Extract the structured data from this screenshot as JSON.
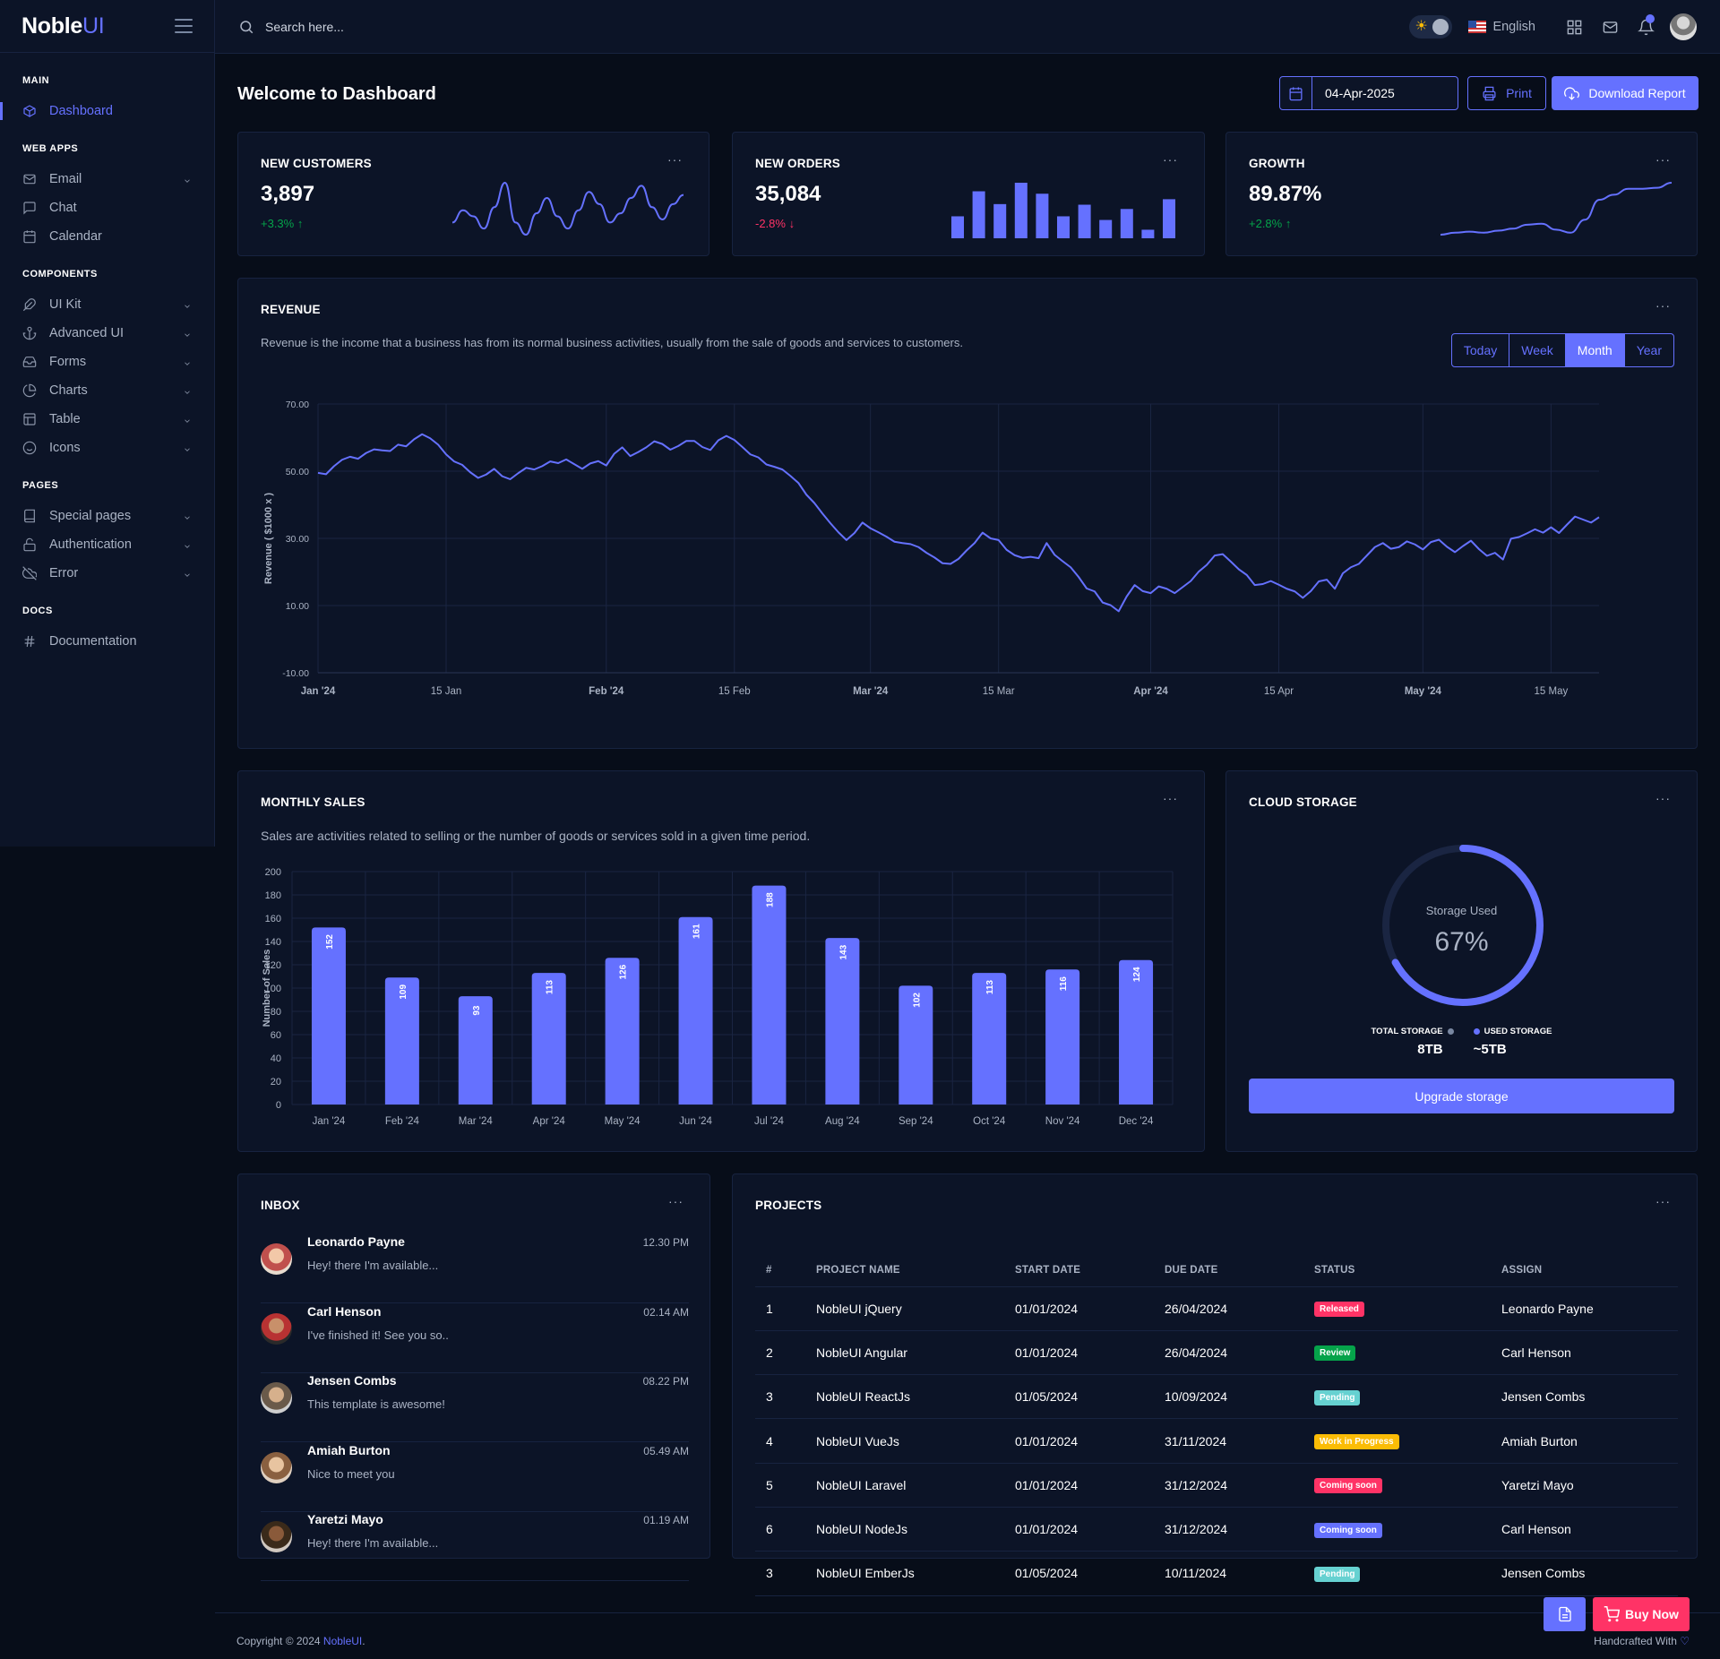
{
  "brand": {
    "name": "Noble",
    "suffix": "UI"
  },
  "search": {
    "placeholder": "Search here..."
  },
  "topbar": {
    "language": "English"
  },
  "sidebar": {
    "groups": [
      {
        "title": "MAIN",
        "items": [
          {
            "label": "Dashboard",
            "icon": "box-icon",
            "active": true
          }
        ]
      },
      {
        "title": "WEB APPS",
        "items": [
          {
            "label": "Email",
            "icon": "mail-icon",
            "chevron": true
          },
          {
            "label": "Chat",
            "icon": "message-square-icon"
          },
          {
            "label": "Calendar",
            "icon": "calendar-icon"
          }
        ]
      },
      {
        "title": "COMPONENTS",
        "items": [
          {
            "label": "UI Kit",
            "icon": "feather-icon",
            "chevron": true
          },
          {
            "label": "Advanced UI",
            "icon": "anchor-icon",
            "chevron": true
          },
          {
            "label": "Forms",
            "icon": "inbox-icon",
            "chevron": true
          },
          {
            "label": "Charts",
            "icon": "pie-chart-icon",
            "chevron": true
          },
          {
            "label": "Table",
            "icon": "layout-icon",
            "chevron": true
          },
          {
            "label": "Icons",
            "icon": "smile-icon",
            "chevron": true
          }
        ]
      },
      {
        "title": "PAGES",
        "items": [
          {
            "label": "Special pages",
            "icon": "book-icon",
            "chevron": true
          },
          {
            "label": "Authentication",
            "icon": "unlock-icon",
            "chevron": true
          },
          {
            "label": "Error",
            "icon": "cloud-off-icon",
            "chevron": true
          }
        ]
      },
      {
        "title": "DOCS",
        "items": [
          {
            "label": "Documentation",
            "icon": "hash-icon"
          }
        ]
      }
    ]
  },
  "header": {
    "title": "Welcome to Dashboard",
    "date": "04-Apr-2025",
    "print_label": "Print",
    "download_label": "Download Report"
  },
  "kpis": [
    {
      "title": "NEW CUSTOMERS",
      "value": "3,897",
      "change": "+3.3%",
      "direction": "up"
    },
    {
      "title": "NEW ORDERS",
      "value": "35,084",
      "change": "-2.8%",
      "direction": "down"
    },
    {
      "title": "GROWTH",
      "value": "89.87%",
      "change": "+2.8%",
      "direction": "up"
    }
  ],
  "revenue": {
    "title": "REVENUE",
    "description": "Revenue is the income that a business has from its normal business activities, usually from the sale of goods and services to customers.",
    "ranges": [
      "Today",
      "Week",
      "Month",
      "Year"
    ],
    "active_range": "Month"
  },
  "monthly_sales": {
    "title": "MONTHLY SALES",
    "description": "Sales are activities related to selling or the number of goods or services sold in a given time period."
  },
  "cloud_storage": {
    "title": "CLOUD STORAGE",
    "label": "Storage Used",
    "percent": "67%",
    "percent_value": 67,
    "total_label": "TOTAL STORAGE",
    "total_value": "8TB",
    "used_label": "USED STORAGE",
    "used_value": "~5TB",
    "button": "Upgrade storage"
  },
  "inbox": {
    "title": "INBOX",
    "items": [
      {
        "name": "Leonardo Payne",
        "time": "12.30 PM",
        "message": "Hey! there I'm available..."
      },
      {
        "name": "Carl Henson",
        "time": "02.14 AM",
        "message": "I've finished it! See you so.."
      },
      {
        "name": "Jensen Combs",
        "time": "08.22 PM",
        "message": "This template is awesome!"
      },
      {
        "name": "Amiah Burton",
        "time": "05.49 AM",
        "message": "Nice to meet you"
      },
      {
        "name": "Yaretzi Mayo",
        "time": "01.19 AM",
        "message": "Hey! there I'm available..."
      }
    ]
  },
  "projects": {
    "title": "PROJECTS",
    "columns": [
      "#",
      "PROJECT NAME",
      "START DATE",
      "DUE DATE",
      "STATUS",
      "ASSIGN"
    ],
    "rows": [
      {
        "num": "1",
        "name": "NobleUI jQuery",
        "start": "01/01/2024",
        "due": "26/04/2024",
        "status": "Released",
        "status_color": "#ff3366",
        "assign": "Leonardo Payne"
      },
      {
        "num": "2",
        "name": "NobleUI Angular",
        "start": "01/01/2024",
        "due": "26/04/2024",
        "status": "Review",
        "status_color": "#05a34a",
        "assign": "Carl Henson"
      },
      {
        "num": "3",
        "name": "NobleUI ReactJs",
        "start": "01/05/2024",
        "due": "10/09/2024",
        "status": "Pending",
        "status_color": "#66d1d1",
        "assign": "Jensen Combs"
      },
      {
        "num": "4",
        "name": "NobleUI VueJs",
        "start": "01/01/2024",
        "due": "31/11/2024",
        "status": "Work in Progress",
        "status_color": "#fbbc06",
        "assign": "Amiah Burton"
      },
      {
        "num": "5",
        "name": "NobleUI Laravel",
        "start": "01/01/2024",
        "due": "31/12/2024",
        "status": "Coming soon",
        "status_color": "#ff3366",
        "assign": "Yaretzi Mayo"
      },
      {
        "num": "6",
        "name": "NobleUI NodeJs",
        "start": "01/01/2024",
        "due": "31/12/2024",
        "status": "Coming soon",
        "status_color": "#6571ff",
        "assign": "Carl Henson"
      },
      {
        "num": "3",
        "name": "NobleUI EmberJs",
        "start": "01/05/2024",
        "due": "10/11/2024",
        "status": "Pending",
        "status_color": "#66d1d1",
        "assign": "Jensen Combs"
      }
    ]
  },
  "footer": {
    "copyright": "Copyright © 2024 ",
    "brand": "NobleUI",
    "end": ".",
    "handcrafted": "Handcrafted With"
  },
  "floating": {
    "buy_label": "Buy Now"
  },
  "colors": {
    "accent": "#6571ff",
    "success": "#05a34a",
    "danger": "#ff3366",
    "warning": "#fbbc06",
    "info": "#66d1d1"
  },
  "chart_data": [
    {
      "type": "line",
      "title": "NEW CUSTOMERS sparkline",
      "values": [
        42,
        46,
        44,
        40,
        47,
        55,
        42,
        38,
        45,
        50,
        44,
        40,
        46,
        52,
        48,
        42,
        45,
        50,
        54,
        47,
        43,
        48,
        51
      ]
    },
    {
      "type": "bar",
      "title": "NEW ORDERS sparkline",
      "values": [
        36,
        77,
        56,
        91,
        73,
        36,
        55,
        30,
        48,
        14,
        64
      ]
    },
    {
      "type": "line",
      "title": "GROWTH sparkline",
      "values": [
        20,
        22,
        23,
        22,
        24,
        26,
        30,
        31,
        25,
        22,
        35,
        55,
        60,
        66,
        66,
        67,
        72
      ]
    },
    {
      "type": "line",
      "title": "REVENUE",
      "ylabel": "Revenue ( $1000 x )",
      "ylim": [
        -10,
        70
      ],
      "yticks": [
        "70.00",
        "50.00",
        "30.00",
        "10.00",
        "-10.00"
      ],
      "xticks": [
        "Jan '24",
        "15 Jan",
        "Feb '24",
        "15 Feb",
        "Mar '24",
        "15 Mar",
        "Apr '24",
        "15 Apr",
        "May '24",
        "15 May"
      ],
      "values": [
        49.5,
        49.1,
        51.5,
        53.4,
        54.3,
        53.7,
        55.4,
        56.5,
        56.2,
        56.0,
        57.9,
        57.4,
        59.5,
        61.0,
        59.8,
        57.9,
        55.0,
        52.9,
        51.9,
        49.7,
        48.0,
        49.0,
        50.7,
        48.5,
        47.6,
        49.4,
        51.0,
        50.5,
        51.5,
        52.9,
        52.4,
        53.5,
        52.1,
        50.7,
        52.3,
        53.0,
        51.7,
        55.2,
        57.1,
        54.5,
        55.7,
        57.1,
        58.9,
        58.1,
        56.4,
        57.5,
        59.0,
        59.0,
        57.2,
        56.3,
        59.2,
        60.5,
        59.3,
        57.2,
        55.0,
        54.1,
        52.0,
        51.3,
        50.5,
        48.6,
        46.5,
        43.0,
        40.5,
        37.4,
        34.5,
        31.8,
        29.5,
        31.6,
        34.7,
        33.0,
        31.8,
        30.5,
        29.0,
        28.6,
        28.3,
        27.4,
        25.7,
        24.3,
        22.6,
        22.4,
        23.9,
        26.4,
        28.6,
        31.7,
        30.0,
        29.5,
        26.6,
        25.0,
        24.2,
        24.5,
        24.1,
        28.6,
        25.1,
        23.2,
        21.4,
        18.5,
        15.1,
        14.2,
        10.9,
        10.1,
        8.3,
        12.7,
        16.1,
        14.3,
        13.7,
        15.7,
        15.0,
        13.7,
        15.5,
        17.3,
        20.1,
        22.1,
        24.9,
        25.3,
        23.1,
        20.8,
        19.1,
        16.1,
        16.4,
        17.3,
        16.2,
        15.0,
        14.2,
        12.3,
        14.3,
        17.2,
        17.7,
        15.0,
        19.6,
        21.4,
        22.4,
        24.9,
        27.4,
        28.6,
        26.9,
        27.4,
        29.1,
        28.2,
        26.7,
        28.9,
        29.6,
        27.5,
        25.9,
        27.7,
        29.3,
        26.8,
        24.8,
        25.7,
        23.7,
        29.9,
        30.4,
        31.5,
        32.7,
        31.7,
        33.3,
        31.6,
        34.1,
        36.5,
        35.6,
        34.7,
        36.3
      ]
    },
    {
      "type": "bar",
      "title": "MONTHLY SALES",
      "ylabel": "Number of Sales",
      "ylim": [
        0,
        200
      ],
      "categories": [
        "Jan '24",
        "Feb '24",
        "Mar '24",
        "Apr '24",
        "May '24",
        "Jun '24",
        "Jul '24",
        "Aug '24",
        "Sep '24",
        "Oct '24",
        "Nov '24",
        "Dec '24"
      ],
      "values": [
        152,
        109,
        93,
        113,
        126,
        161,
        188,
        143,
        102,
        113,
        116,
        124
      ]
    },
    {
      "type": "pie",
      "title": "Storage Used",
      "values": [
        67,
        33
      ]
    }
  ]
}
